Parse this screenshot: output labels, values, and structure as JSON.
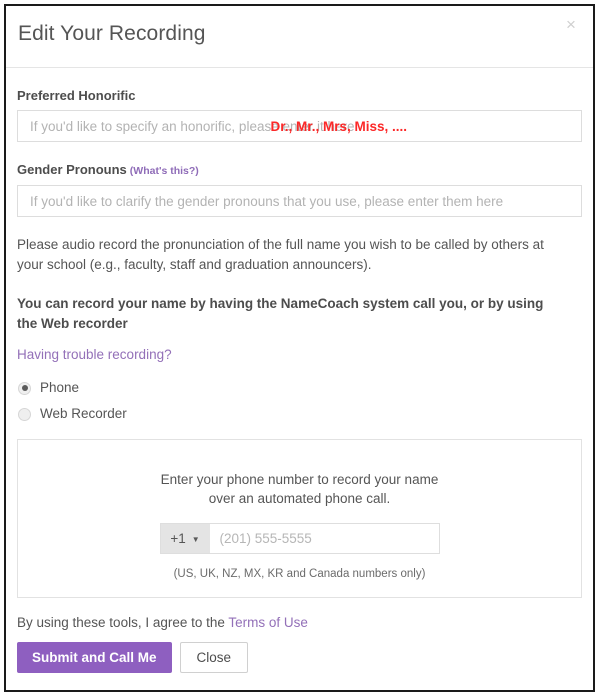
{
  "modal": {
    "title": "Edit Your Recording",
    "close_icon": "close-icon",
    "close_glyph": "×"
  },
  "honorific": {
    "label": "Preferred Honorific",
    "placeholder": "If you'd like to specify an honorific, please enter it here",
    "value": "",
    "hint_text": "Dr., Mr., Mrs, Miss, ....",
    "hint_color": "#fc2828"
  },
  "pronouns": {
    "label": "Gender Pronouns",
    "hint_link": "(What's this?)",
    "placeholder": "If you'd like to clarify the gender pronouns that you use, please enter them here",
    "value": ""
  },
  "instructions": {
    "paragraph": "Please audio record the pronunciation of the full name you wish to be called by others at your school (e.g., faculty, staff and graduation announcers).",
    "bold_paragraph": "You can record your name by having the NameCoach system call you, or by using the Web recorder",
    "trouble_link": "Having trouble recording?"
  },
  "method": {
    "options": [
      {
        "label": "Phone",
        "selected": true
      },
      {
        "label": "Web Recorder",
        "selected": false
      }
    ]
  },
  "phone_panel": {
    "prompt_line1": "Enter your phone number to record your name",
    "prompt_line2": "over an automated phone call.",
    "country_code": "+1",
    "caret_glyph": "▼",
    "number_placeholder": "(201) 555-5555",
    "number_value": "",
    "note": "(US, UK, NZ, MX, KR and Canada numbers only)"
  },
  "footer": {
    "terms_prefix": "By using these tools, I agree to the ",
    "terms_link": "Terms of Use",
    "submit_label": "Submit and Call Me",
    "close_label": "Close",
    "accent_color": "#8e5fc0",
    "link_color": "#9370b8"
  }
}
